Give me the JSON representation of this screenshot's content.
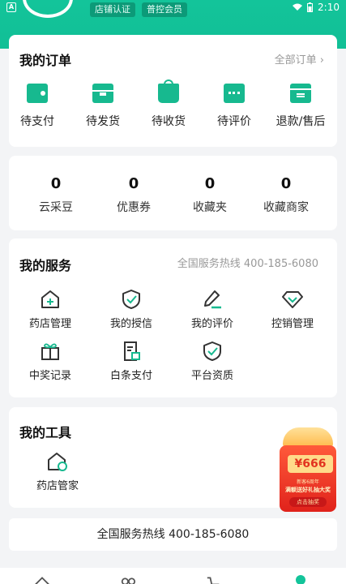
{
  "status_bar": {
    "time": "2:10",
    "battery_icon": "battery-icon",
    "wifi_icon": "wifi-icon",
    "app_badge": "A"
  },
  "header": {
    "tags": [
      "店铺认证",
      "普控会员"
    ]
  },
  "orders": {
    "title": "我的订单",
    "all_link": "全部订单 ›",
    "items": [
      {
        "label": "待支付",
        "icon": "wallet-icon"
      },
      {
        "label": "待发货",
        "icon": "package-icon"
      },
      {
        "label": "待收货",
        "icon": "shopping-bag-icon"
      },
      {
        "label": "待评价",
        "icon": "comment-icon"
      },
      {
        "label": "退款/售后",
        "icon": "refund-icon"
      }
    ]
  },
  "stats": [
    {
      "value": "0",
      "label": "云采豆"
    },
    {
      "value": "0",
      "label": "优惠券"
    },
    {
      "value": "0",
      "label": "收藏夹"
    },
    {
      "value": "0",
      "label": "收藏商家"
    }
  ],
  "services": {
    "title": "我的服务",
    "hotline": "全国服务热线 400-185-6080",
    "items": [
      {
        "label": "药店管理",
        "icon": "pharmacy-icon"
      },
      {
        "label": "我的授信",
        "icon": "shield-check-icon"
      },
      {
        "label": "我的评价",
        "icon": "pen-icon"
      },
      {
        "label": "控销管理",
        "icon": "diamond-icon"
      },
      {
        "label": "中奖记录",
        "icon": "gift-icon"
      },
      {
        "label": "白条支付",
        "icon": "bill-icon"
      },
      {
        "label": "平台资质",
        "icon": "certified-icon"
      }
    ]
  },
  "tools": {
    "title": "我的工具",
    "items": [
      {
        "label": "药店管家",
        "icon": "store-gear-icon"
      }
    ]
  },
  "promo": {
    "amount": "¥666",
    "line1": "新客6周年",
    "line2": "满额送好礼抽大奖",
    "button": "点击抽奖"
  },
  "footer_hotline": "全国服务热线 400-185-6080",
  "tabbar": [
    "home-icon",
    "category-icon",
    "cart-icon",
    "profile-icon"
  ],
  "colors": {
    "brand": "#13c49a",
    "background": "#f3f4f6"
  }
}
